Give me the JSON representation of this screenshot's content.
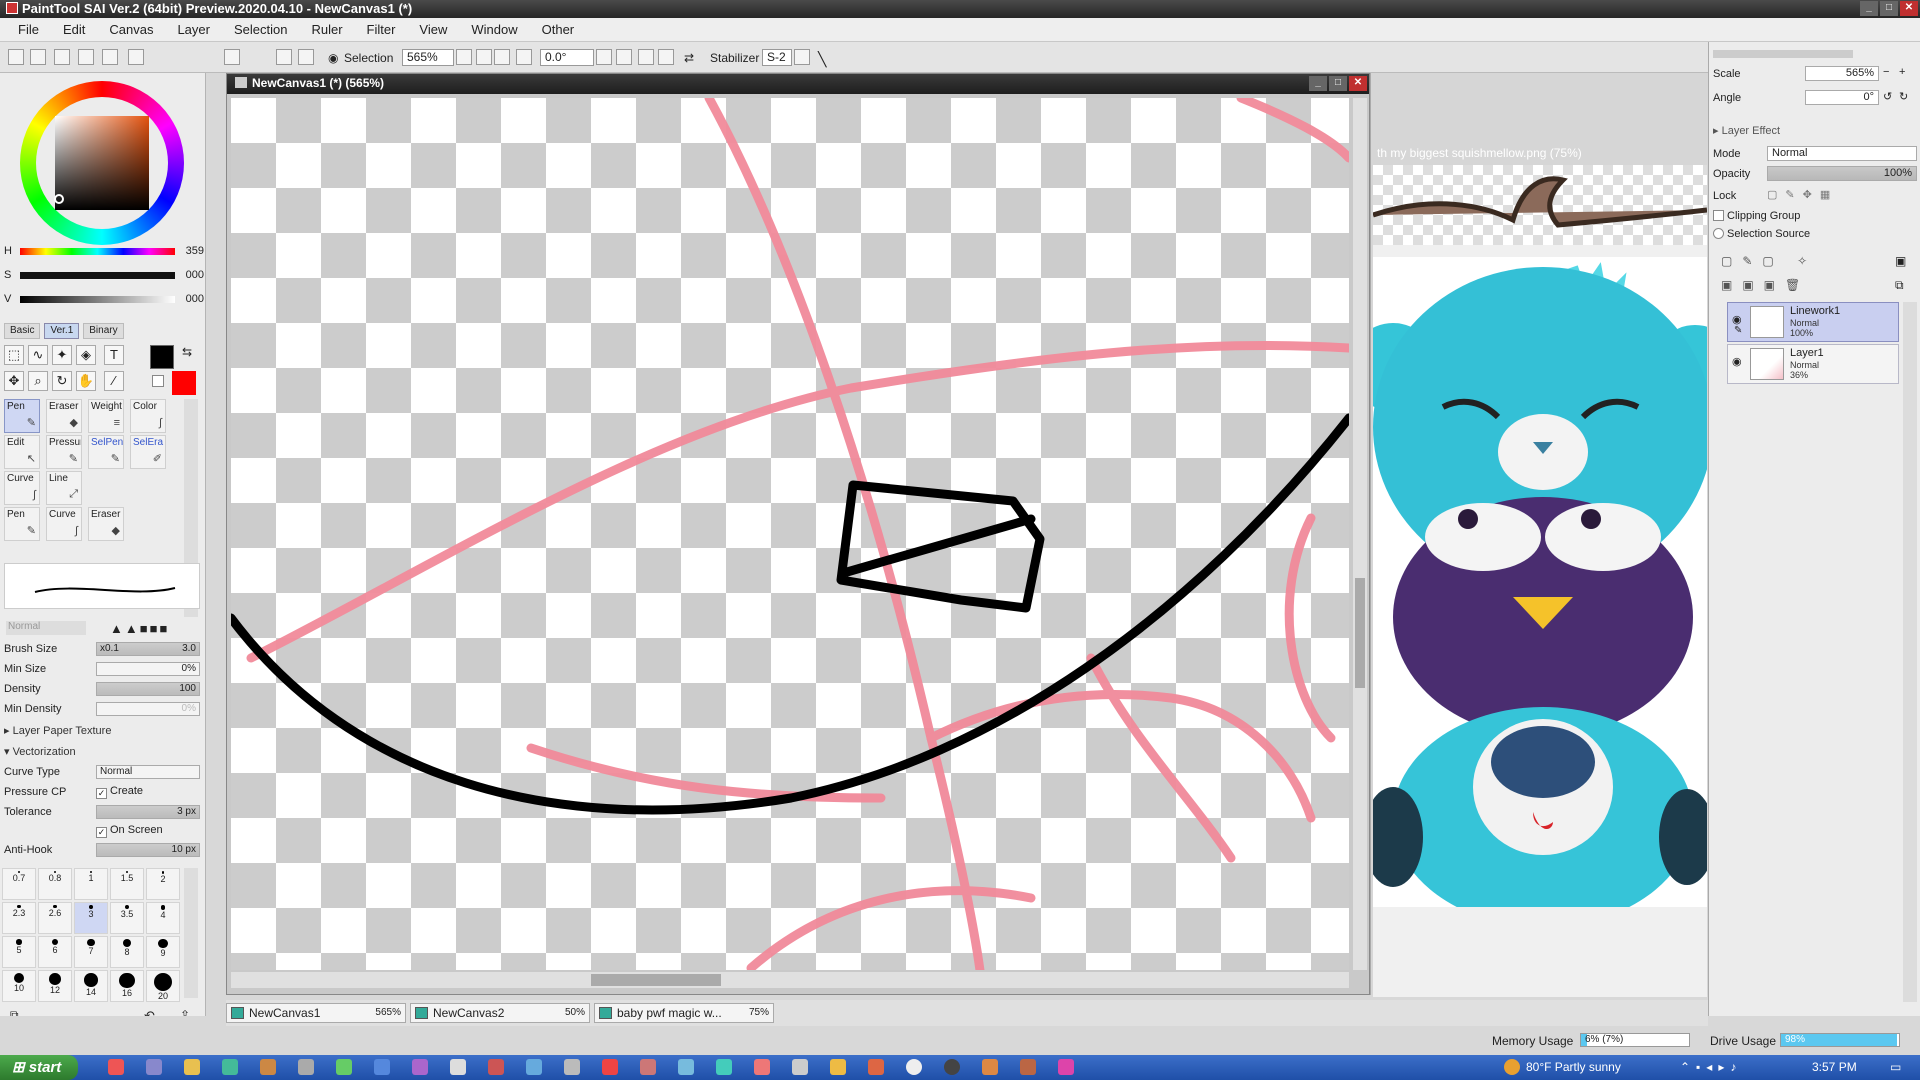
{
  "window": {
    "title": "PaintTool SAI Ver.2 (64bit) Preview.2020.04.10 - NewCanvas1 (*)"
  },
  "menu": [
    "File",
    "Edit",
    "Canvas",
    "Layer",
    "Selection",
    "Ruler",
    "Filter",
    "View",
    "Window",
    "Other"
  ],
  "toolbar": {
    "selection_label": "Selection",
    "zoom": "565%",
    "rotation": "0.0°",
    "stabilizer_label": "Stabilizer",
    "stabilizer_value": "S-2"
  },
  "color": {
    "h_label": "H",
    "h_value": "359",
    "s_label": "S",
    "s_value": "000",
    "v_label": "V",
    "v_value": "000",
    "primary": "#000000",
    "secondary": "#ff0000"
  },
  "tool_tabs": [
    "Basic",
    "Ver.1",
    "Binary"
  ],
  "brushes": [
    {
      "label": "Pen",
      "active": true
    },
    {
      "label": "Eraser"
    },
    {
      "label": "Weight"
    },
    {
      "label": "Color"
    },
    {
      "label": "Edit"
    },
    {
      "label": "Pressure"
    },
    {
      "label": "SelPen"
    },
    {
      "label": "SelEra"
    },
    {
      "label": "Curve"
    },
    {
      "label": "Line"
    },
    {
      "label": "Pen"
    },
    {
      "label": "Curve"
    },
    {
      "label": "Eraser"
    }
  ],
  "brush_params": {
    "blend_mode": "Normal",
    "brush_size_label": "Brush Size",
    "brush_size_mult": "x0.1",
    "brush_size_value": "3.0",
    "min_size_label": "Min Size",
    "min_size_value": "0%",
    "density_label": "Density",
    "density_value": "100",
    "min_density_label": "Min Density",
    "min_density_value": "0%"
  },
  "layer_paper_texture": "Layer Paper Texture",
  "vectorization": {
    "header": "Vectorization",
    "curve_type_label": "Curve Type",
    "curve_type_value": "Normal",
    "pressure_label": "Pressure CP",
    "create_label": "Create",
    "tolerance_label": "Tolerance",
    "tolerance_value": "3 px",
    "on_screen_label": "On Screen",
    "anti_hook_label": "Anti-Hook",
    "anti_hook_value": "10 px"
  },
  "brush_dots": [
    "0.7",
    "0.8",
    "1",
    "1.5",
    "2",
    "2.3",
    "2.6",
    "3",
    "3.5",
    "4",
    "5",
    "6",
    "7",
    "8",
    "9",
    "10",
    "12",
    "14",
    "16",
    "20"
  ],
  "canvas_window": {
    "title": "NewCanvas1 (*) (565%)"
  },
  "reference": {
    "title": "th my biggest squishmellow.png (75%)"
  },
  "right_panel": {
    "scale_label": "Scale",
    "scale_value": "565%",
    "angle_label": "Angle",
    "angle_value": "0°",
    "layer_effect_label": "Layer Effect",
    "mode_label": "Mode",
    "mode_value": "Normal",
    "opacity_label": "Opacity",
    "opacity_value": "100%",
    "lock_label": "Lock",
    "clipping_label": "Clipping Group",
    "selection_source_label": "Selection Source"
  },
  "layers": [
    {
      "name": "Linework1",
      "mode": "Normal",
      "opacity": "100%",
      "active": true
    },
    {
      "name": "Layer1",
      "mode": "Normal",
      "opacity": "36%",
      "active": false
    }
  ],
  "doc_tabs": [
    {
      "name": "NewCanvas1",
      "zoom": "565%"
    },
    {
      "name": "NewCanvas2",
      "zoom": "50%"
    },
    {
      "name": "baby pwf magic w...",
      "zoom": "75%"
    }
  ],
  "status": {
    "memory_label": "Memory Usage",
    "memory_value": "6% (7%)",
    "memory_fraction": 0.06,
    "drive_label": "Drive Usage",
    "drive_value": "98%",
    "drive_fraction": 0.98
  },
  "taskbar": {
    "start_label": "start",
    "weather": "80°F Partly sunny",
    "time": "3:57 PM"
  }
}
